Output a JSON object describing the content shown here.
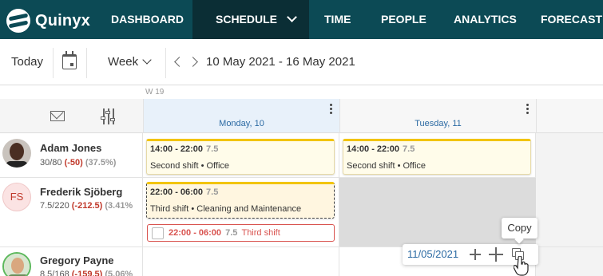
{
  "brand": {
    "name": "Quinyx"
  },
  "nav": {
    "items": [
      {
        "label": "DASHBOARD"
      },
      {
        "label": "SCHEDULE"
      },
      {
        "label": "TIME"
      },
      {
        "label": "PEOPLE"
      },
      {
        "label": "ANALYTICS"
      },
      {
        "label": "FORECAST"
      }
    ],
    "active": "SCHEDULE"
  },
  "toolbar": {
    "today_label": "Today",
    "view_label": "Week",
    "range_label": "10 May 2021 - 16 May 2021"
  },
  "grid": {
    "week_label": "W 19",
    "days": [
      {
        "label": "Monday, 10"
      },
      {
        "label": "Tuesday, 11"
      }
    ]
  },
  "employees": [
    {
      "name": "Adam Jones",
      "hours": "30/80",
      "diff": "(-50)",
      "pct": "(37.5%)"
    },
    {
      "name": "Frederik Sjöberg",
      "initials": "FS",
      "hours": "7.5/220",
      "diff": "(-212.5)",
      "pct": "(3.41%"
    },
    {
      "name": "Gregory Payne",
      "hours": "8.5/168",
      "diff": "(-159.5)",
      "pct": "(5.06%"
    }
  ],
  "shifts": {
    "adam_mon": {
      "time": "14:00 - 22:00",
      "duration": "7.5",
      "desc": "Second shift • Office"
    },
    "adam_tue": {
      "time": "14:00 - 22:00",
      "duration": "7.5",
      "desc": "Second shift • Office"
    },
    "fred_mon": {
      "time": "22:00 - 06:00",
      "duration": "7.5",
      "desc": "Third shift • Cleaning and Maintenance"
    },
    "fred_mon_red": {
      "time": "22:00 - 06:00",
      "duration": "7.5",
      "name": "Third shift"
    }
  },
  "hover_toolbar": {
    "date": "11/05/2021",
    "tooltip": "Copy"
  },
  "colors": {
    "nav_bg": "#0c4a55",
    "nav_active_bg": "#0b2e35",
    "shift_accent": "#f2c400",
    "negative": "#c0392b",
    "link_blue": "#2b6aa3"
  }
}
